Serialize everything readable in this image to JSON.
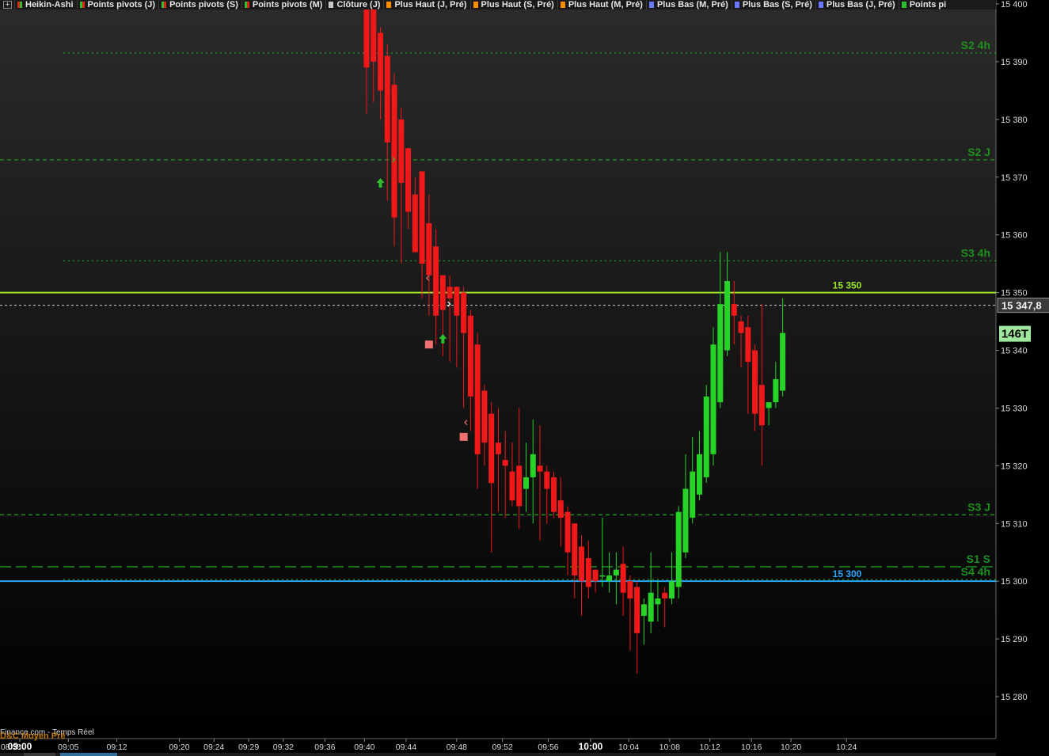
{
  "legend": {
    "add_symbol": "+",
    "items": [
      {
        "label": "Heikin-Ashi",
        "color": "#e2231a",
        "color2": "#2dbf2d"
      },
      {
        "label": "Points pivots (J)",
        "color": "#2dbf2d",
        "color2": "#e2231a"
      },
      {
        "label": "Points pivots (S)",
        "color": "#2dbf2d",
        "color2": "#e2231a"
      },
      {
        "label": "Points pivots (M)",
        "color": "#2dbf2d",
        "color2": "#e2231a"
      },
      {
        "label": "Clôture (J)",
        "color": "#c8c8c8"
      },
      {
        "label": "Plus Haut (J, Pré)",
        "color": "#ff8c00"
      },
      {
        "label": "Plus Haut (S, Pré)",
        "color": "#ff8c00"
      },
      {
        "label": "Plus Haut (M, Pré)",
        "color": "#ff8c00"
      },
      {
        "label": "Plus Bas (M, Pré)",
        "color": "#6a78ff"
      },
      {
        "label": "Plus Bas (S, Pré)",
        "color": "#6a78ff"
      },
      {
        "label": "Plus Bas (J, Pré)",
        "color": "#6a78ff"
      },
      {
        "label": "Points pi",
        "color": "#2dbf2d"
      }
    ]
  },
  "footer": {
    "source": "Finance.com - Temps Réel",
    "overlay": "D&C Moyen Pré"
  },
  "colors": {
    "up": "#27d327",
    "down": "#f01818",
    "background_top": "#2b2b2b",
    "background_bottom": "#000000",
    "pivot": "#1f9a1f",
    "pivot_label": "#1e8f1e",
    "level_15350": "#9be52a",
    "level_15300": "#2aa8ff",
    "axis_text": "#d9d9d9"
  },
  "chart_data": {
    "type": "candlestick",
    "style": "Heikin-Ashi",
    "ylim": [
      15276,
      15400
    ],
    "y_ticks": [
      15400,
      15390,
      15380,
      15370,
      15360,
      15350,
      15340,
      15330,
      15320,
      15310,
      15300,
      15290,
      15280
    ],
    "y_tick_labels": [
      "15 400",
      "15 390",
      "15 380",
      "15 370",
      "15 360",
      "15 350",
      "15 340",
      "15 330",
      "15 320",
      "15 310",
      "15 300",
      "15 290",
      "15 280"
    ],
    "x_tick_labels": [
      {
        "label": "08:33",
        "index": -55,
        "bold": false
      },
      {
        "label": "09:00",
        "index": -50,
        "bold": true
      },
      {
        "label": "09:05",
        "index": -43,
        "bold": false
      },
      {
        "label": "09:12",
        "index": -36,
        "bold": false
      },
      {
        "label": "09:20",
        "index": -27,
        "bold": false
      },
      {
        "label": "09:24",
        "index": -22,
        "bold": false
      },
      {
        "label": "09:29",
        "index": -17,
        "bold": false
      },
      {
        "label": "09:32",
        "index": -12,
        "bold": false
      },
      {
        "label": "09:36",
        "index": -6,
        "bold": false
      },
      {
        "label": "09:40",
        "index": -0.3,
        "bold": false
      },
      {
        "label": "09:44",
        "index": 5.7,
        "bold": false
      },
      {
        "label": "09:48",
        "index": 13,
        "bold": false
      },
      {
        "label": "09:52",
        "index": 19.6,
        "bold": false
      },
      {
        "label": "09:56",
        "index": 26.2,
        "bold": false
      },
      {
        "label": "10:00",
        "index": 32.3,
        "bold": true
      },
      {
        "label": "10:04",
        "index": 37.8,
        "bold": false
      },
      {
        "label": "10:08",
        "index": 43.7,
        "bold": false
      },
      {
        "label": "10:12",
        "index": 49.5,
        "bold": false
      },
      {
        "label": "10:16",
        "index": 55.5,
        "bold": false
      },
      {
        "label": "10:20",
        "index": 61.2,
        "bold": false
      },
      {
        "label": "10:24",
        "index": 69.2,
        "bold": false
      }
    ],
    "candles": [
      {
        "o": 15405,
        "h": 15405,
        "l": 15381,
        "c": 15389
      },
      {
        "o": 15404,
        "h": 15405,
        "l": 15383,
        "c": 15390
      },
      {
        "o": 15395,
        "h": 15396,
        "l": 15380,
        "c": 15385
      },
      {
        "o": 15391,
        "h": 15393,
        "l": 15366,
        "c": 15376
      },
      {
        "o": 15386,
        "h": 15388,
        "l": 15358,
        "c": 15363
      },
      {
        "o": 15380,
        "h": 15382,
        "l": 15355,
        "c": 15369
      },
      {
        "o": 15375,
        "h": 15375,
        "l": 15361,
        "c": 15364
      },
      {
        "o": 15367,
        "h": 15370,
        "l": 15357,
        "c": 15357
      },
      {
        "o": 15371,
        "h": 15371,
        "l": 15349,
        "c": 15355
      },
      {
        "o": 15362,
        "h": 15367,
        "l": 15346,
        "c": 15353
      },
      {
        "o": 15358,
        "h": 15361,
        "l": 15341,
        "c": 15346
      },
      {
        "o": 15353,
        "h": 15353,
        "l": 15339,
        "c": 15347
      },
      {
        "o": 15351,
        "h": 15353,
        "l": 15338,
        "c": 15349
      },
      {
        "o": 15351,
        "h": 15351,
        "l": 15337,
        "c": 15346
      },
      {
        "o": 15350,
        "h": 15351,
        "l": 15330,
        "c": 15343
      },
      {
        "o": 15346,
        "h": 15347,
        "l": 15326,
        "c": 15332
      },
      {
        "o": 15341,
        "h": 15343,
        "l": 15316,
        "c": 15322
      },
      {
        "o": 15333,
        "h": 15334,
        "l": 15320,
        "c": 15324
      },
      {
        "o": 15329,
        "h": 15331,
        "l": 15305,
        "c": 15317
      },
      {
        "o": 15324,
        "h": 15330,
        "l": 15312,
        "c": 15322
      },
      {
        "o": 15321,
        "h": 15326,
        "l": 15311,
        "c": 15320
      },
      {
        "o": 15319,
        "h": 15324,
        "l": 15313,
        "c": 15314
      },
      {
        "o": 15320,
        "h": 15330,
        "l": 15309,
        "c": 15313
      },
      {
        "o": 15316,
        "h": 15324,
        "l": 15312,
        "c": 15318
      },
      {
        "o": 15318,
        "h": 15328,
        "l": 15310,
        "c": 15322
      },
      {
        "o": 15320,
        "h": 15327,
        "l": 15307,
        "c": 15319
      },
      {
        "o": 15319,
        "h": 15320,
        "l": 15310,
        "c": 15316
      },
      {
        "o": 15318,
        "h": 15319,
        "l": 15311,
        "c": 15312
      },
      {
        "o": 15314,
        "h": 15318,
        "l": 15306,
        "c": 15311
      },
      {
        "o": 15312,
        "h": 15313,
        "l": 15301,
        "c": 15305
      },
      {
        "o": 15310,
        "h": 15310,
        "l": 15297,
        "c": 15301
      },
      {
        "o": 15306,
        "h": 15308,
        "l": 15294,
        "c": 15300
      },
      {
        "o": 15304,
        "h": 15307,
        "l": 15297,
        "c": 15299
      },
      {
        "o": 15302,
        "h": 15302,
        "l": 15298,
        "c": 15300
      },
      {
        "o": 15301,
        "h": 15311,
        "l": 15299,
        "c": 15301
      },
      {
        "o": 15300,
        "h": 15305,
        "l": 15298,
        "c": 15301
      },
      {
        "o": 15301,
        "h": 15305,
        "l": 15296,
        "c": 15302
      },
      {
        "o": 15303,
        "h": 15306,
        "l": 15294,
        "c": 15298
      },
      {
        "o": 15300,
        "h": 15301,
        "l": 15288,
        "c": 15297
      },
      {
        "o": 15299,
        "h": 15300,
        "l": 15284,
        "c": 15291
      },
      {
        "o": 15294,
        "h": 15297,
        "l": 15289,
        "c": 15296
      },
      {
        "o": 15293,
        "h": 15305,
        "l": 15291,
        "c": 15298
      },
      {
        "o": 15296,
        "h": 15300,
        "l": 15293,
        "c": 15297
      },
      {
        "o": 15298,
        "h": 15299,
        "l": 15292,
        "c": 15297
      },
      {
        "o": 15297,
        "h": 15305,
        "l": 15296,
        "c": 15300
      },
      {
        "o": 15299,
        "h": 15313,
        "l": 15297,
        "c": 15312
      },
      {
        "o": 15305,
        "h": 15322,
        "l": 15304,
        "c": 15316
      },
      {
        "o": 15311,
        "h": 15325,
        "l": 15310,
        "c": 15319
      },
      {
        "o": 15315,
        "h": 15326,
        "l": 15314,
        "c": 15322
      },
      {
        "o": 15318,
        "h": 15334,
        "l": 15317,
        "c": 15332
      },
      {
        "o": 15322,
        "h": 15344,
        "l": 15320,
        "c": 15341
      },
      {
        "o": 15331,
        "h": 15357,
        "l": 15330,
        "c": 15348
      },
      {
        "o": 15340,
        "h": 15357,
        "l": 15339,
        "c": 15352
      },
      {
        "o": 15348,
        "h": 15352,
        "l": 15341,
        "c": 15346
      },
      {
        "o": 15345,
        "h": 15346,
        "l": 15337,
        "c": 15343
      },
      {
        "o": 15344,
        "h": 15346,
        "l": 15329,
        "c": 15338
      },
      {
        "o": 15340,
        "h": 15341,
        "l": 15326,
        "c": 15329
      },
      {
        "o": 15334,
        "h": 15348,
        "l": 15320,
        "c": 15327
      },
      {
        "o": 15330,
        "h": 15331,
        "l": 15327,
        "c": 15331
      },
      {
        "o": 15331,
        "h": 15338,
        "l": 15330,
        "c": 15335
      },
      {
        "o": 15333,
        "h": 15349,
        "l": 15332,
        "c": 15343
      }
    ],
    "levels": [
      {
        "label": "S2 4h",
        "value": 15391.5,
        "style": "dotted",
        "color": "#1f9a1f",
        "from": "mid"
      },
      {
        "label": "S2 J",
        "value": 15373,
        "style": "dashed",
        "color": "#1f9a1f",
        "from": "left"
      },
      {
        "label": "S3 4h",
        "value": 15355.5,
        "style": "dotted",
        "color": "#1f9a1f",
        "from": "mid"
      },
      {
        "label": "15 350",
        "value": 15350,
        "style": "solid",
        "color": "#9be52a",
        "from": "left"
      },
      {
        "label": "S3 J",
        "value": 15311.5,
        "style": "dashed",
        "color": "#1f9a1f",
        "from": "left"
      },
      {
        "label": "S1 S",
        "value": 15302.5,
        "style": "longdash",
        "color": "#1f9a1f",
        "from": "left"
      },
      {
        "label": "15 300",
        "value": 15300,
        "style": "solid",
        "color": "#2aa8ff",
        "from": "left"
      },
      {
        "label": "S4 4h",
        "value": 15300.3,
        "style": "dotted",
        "color": "#1f9a1f",
        "from": "mid"
      }
    ],
    "last_price": {
      "value": 15347.8,
      "label": "15 347,8"
    },
    "tick_counter": "146T",
    "markers": [
      {
        "type": "up-arrow",
        "index": 2,
        "value": 15369,
        "color": "#2dbf2d"
      },
      {
        "type": "up-arrow",
        "index": 11,
        "value": 15342,
        "color": "#2dbf2d"
      },
      {
        "type": "square",
        "index": 9,
        "value": 15341,
        "color": "#f07070"
      },
      {
        "type": "square",
        "index": 14,
        "value": 15325,
        "color": "#f07070"
      },
      {
        "type": "tick-right",
        "index": 2,
        "value": 15373,
        "color": "#2dbf2d"
      },
      {
        "type": "tick-left",
        "index": 9,
        "value": 15352.5,
        "color": "#f07070"
      },
      {
        "type": "tick-right",
        "index": 10,
        "value": 15348,
        "color": "#ffffff"
      },
      {
        "type": "tick-left",
        "index": 14.5,
        "value": 15327.5,
        "color": "#f07070"
      }
    ]
  }
}
